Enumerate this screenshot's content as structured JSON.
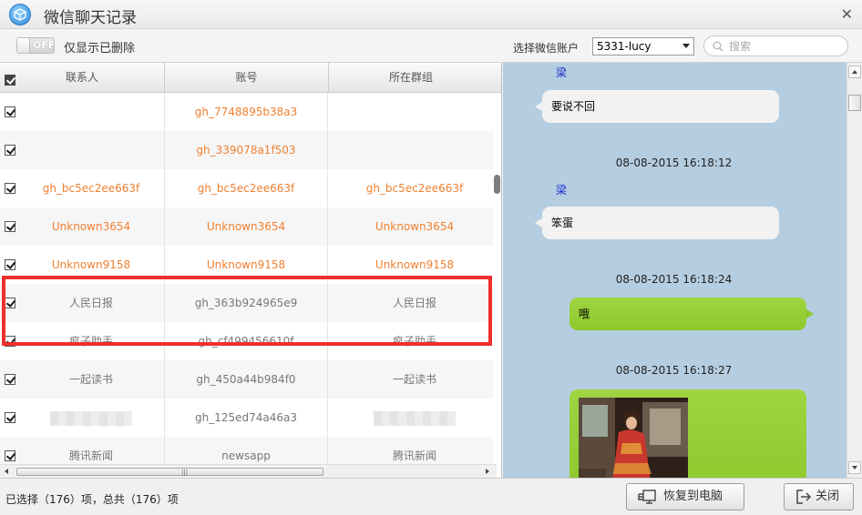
{
  "window": {
    "title": "微信聊天记录"
  },
  "toolbar": {
    "toggle_state": "OFF",
    "only_deleted_label": "仅显示已删除",
    "account_label": "选择微信账户",
    "account_selected": "5331-lucy",
    "search_placeholder": "搜索"
  },
  "table": {
    "headers": [
      "联系人",
      "账号",
      "所在群组"
    ],
    "rows": [
      {
        "contact": "",
        "account": "gh_7748895b38a3",
        "group": "",
        "style": "orange"
      },
      {
        "contact": "",
        "account": "gh_339078a1f503",
        "group": "",
        "style": "orange"
      },
      {
        "contact": "gh_bc5ec2ee663f",
        "account": "gh_bc5ec2ee663f",
        "group": "gh_bc5ec2ee663f",
        "style": "orange"
      },
      {
        "contact": "Unknown3654",
        "account": "Unknown3654",
        "group": "Unknown3654",
        "style": "orange"
      },
      {
        "contact": "Unknown9158",
        "account": "Unknown9158",
        "group": "Unknown9158",
        "style": "orange"
      },
      {
        "contact": "人民日报",
        "account": "gh_363b924965e9",
        "group": "人民日报",
        "style": "gray"
      },
      {
        "contact": "疯子助手",
        "account": "gh_cf499456610f",
        "group": "疯子助手",
        "style": "gray"
      },
      {
        "contact": "一起读书",
        "account": "gh_450a44b984f0",
        "group": "一起读书",
        "style": "gray"
      },
      {
        "contact": "",
        "account": "gh_125ed74a46a3",
        "group": "",
        "style": "gray",
        "blurred": true
      },
      {
        "contact": "腾讯新闻",
        "account": "newsapp",
        "group": "腾讯新闻",
        "style": "gray"
      }
    ]
  },
  "chat": {
    "messages": [
      {
        "sender": "梁",
        "text": "要说不回",
        "dir": "in"
      },
      {
        "timestamp": "08-08-2015 16:18:12"
      },
      {
        "sender": "梁",
        "text": "笨蛋",
        "dir": "in"
      },
      {
        "timestamp": "08-08-2015 16:18:24"
      },
      {
        "text": "哦",
        "dir": "out"
      },
      {
        "timestamp": "08-08-2015 16:18:27"
      }
    ]
  },
  "footer": {
    "status": "已选择（176）项，总共（176）项",
    "restore_label": "恢复到电脑",
    "close_label": "关闭"
  },
  "colors": {
    "highlight": "#ee2f2f",
    "orange_text": "#f08030",
    "chat_bg": "#b5cde0",
    "out_bubble": "#8cc92d"
  }
}
